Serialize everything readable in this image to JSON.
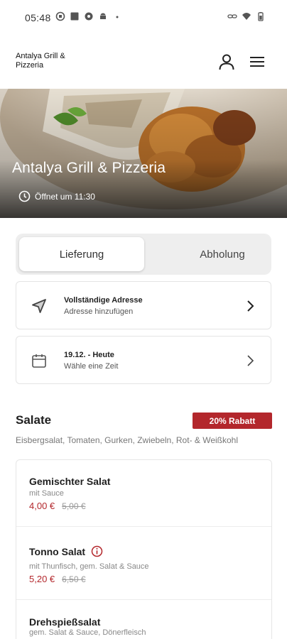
{
  "status_bar": {
    "time": "05:48"
  },
  "header": {
    "brand": "Antalya Grill & Pizzeria"
  },
  "hero": {
    "title": "Antalya Grill & Pizzeria",
    "opening": "Öffnet um 11:30"
  },
  "order_mode": {
    "delivery_label": "Lieferung",
    "pickup_label": "Abholung",
    "selected": "Lieferung"
  },
  "address_card": {
    "title": "Vollständige Adresse",
    "subtitle": "Adresse hinzufügen"
  },
  "time_card": {
    "title": "19.12. - Heute",
    "subtitle": "Wähle eine Zeit"
  },
  "section": {
    "title": "Salate",
    "badge": "20% Rabatt",
    "description": "Eisbergsalat, Tomaten, Gurken, Zwiebeln, Rot- & Weißkohl"
  },
  "items": [
    {
      "name": "Gemischter Salat",
      "description": "mit Sauce",
      "price": "4,00 €",
      "old_price": "5,00 €"
    },
    {
      "name": "Tonno Salat",
      "description": "mit Thunfisch, gem. Salat & Sauce",
      "price": "5,20 €",
      "old_price": "6,50 €"
    },
    {
      "name": "Drehspießsalat",
      "description": "gem. Salat & Sauce, Dönerfleisch",
      "price": "",
      "old_price": ""
    }
  ],
  "colors": {
    "accent": "#b3272c",
    "card_border": "#e4e4e4",
    "toggle_bg": "#eeeeee"
  },
  "icons": [
    "user-icon",
    "menu-icon",
    "clock-icon",
    "location-arrow-icon",
    "calendar-icon",
    "chevron-right-icon",
    "info-circle-icon"
  ]
}
